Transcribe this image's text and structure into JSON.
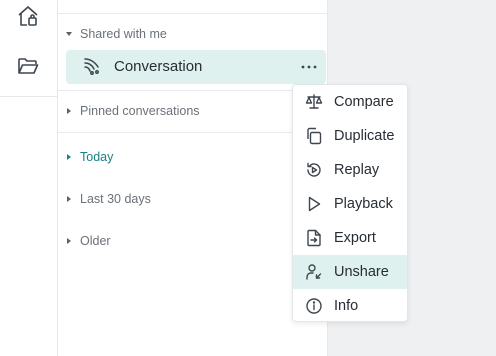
{
  "rail": {
    "items": [
      {
        "icon": "home-icon"
      },
      {
        "icon": "folder-icon"
      }
    ]
  },
  "sidebar": {
    "shared_header": "Shared with me",
    "conversation": {
      "label": "Conversation",
      "icon": "conversation-icon"
    },
    "sections": [
      {
        "label": "Pinned conversations",
        "active": false
      },
      {
        "label": "Today",
        "active": true
      },
      {
        "label": "Last 30 days",
        "active": false
      },
      {
        "label": "Older",
        "active": false
      }
    ]
  },
  "context_menu": {
    "items": [
      {
        "label": "Compare",
        "icon": "scale-icon"
      },
      {
        "label": "Duplicate",
        "icon": "copy-icon"
      },
      {
        "label": "Replay",
        "icon": "replay-icon"
      },
      {
        "label": "Playback",
        "icon": "play-icon"
      },
      {
        "label": "Export",
        "icon": "export-icon"
      },
      {
        "label": "Unshare",
        "icon": "unshare-icon",
        "highlighted": true
      },
      {
        "label": "Info",
        "icon": "info-icon"
      }
    ]
  },
  "colors": {
    "accent": "#1a7f86",
    "highlight": "#dff1ee",
    "main_background": "#eef0f2"
  }
}
